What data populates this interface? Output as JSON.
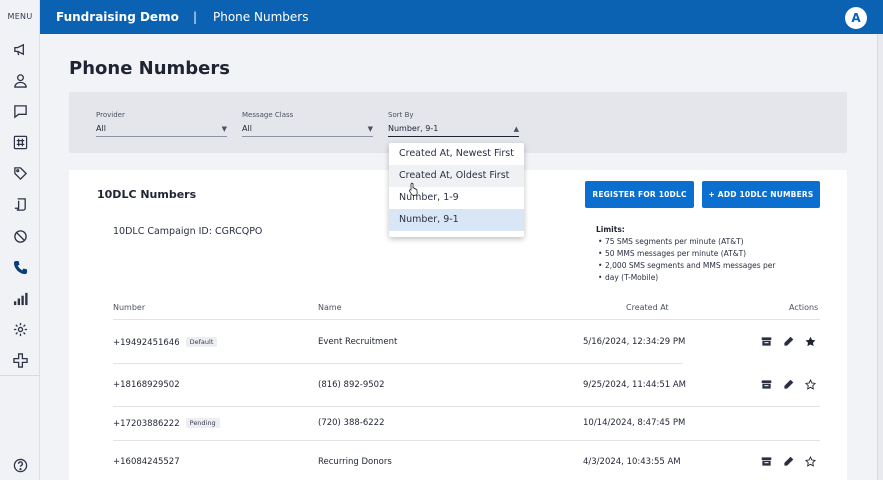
{
  "sidebar": {
    "menu_label": "MENU",
    "icons": [
      "megaphone-icon",
      "person-icon",
      "chat-bubble-icon",
      "hashtag-icon",
      "tag-icon",
      "script-icon",
      "block-icon",
      "phone-icon",
      "bar-chart-icon",
      "gear-icon",
      "puzzle-icon"
    ],
    "help_icon": "help-icon"
  },
  "topbar": {
    "app_title": "Fundraising Demo",
    "separator": "|",
    "breadcrumb": "Phone Numbers",
    "avatar_initial": "A"
  },
  "page": {
    "title": "Phone Numbers"
  },
  "filters": {
    "provider": {
      "label": "Provider",
      "value": "All"
    },
    "message_class": {
      "label": "Message Class",
      "value": "All"
    },
    "sort_by": {
      "label": "Sort By",
      "value": "Number, 9-1"
    }
  },
  "sort_dropdown": {
    "options": [
      "Created At, Newest First",
      "Created At, Oldest First",
      "Number, 1-9",
      "Number, 9-1"
    ],
    "hovered": "Created At, Oldest First",
    "selected": "Number, 9-1"
  },
  "card": {
    "title": "10DLC Numbers",
    "register_button": "REGISTER FOR 10DLC",
    "add_button": "+ ADD 10DLC NUMBERS",
    "campaign_id": "10DLC Campaign ID: CGRCQPO",
    "limits_title": "Limits:",
    "limits": [
      "75 SMS segments per minute (AT&T)",
      "50 MMS messages per minute (AT&T)",
      "2,000 SMS segments and MMS messages per",
      "day (T-Mobile)"
    ]
  },
  "table": {
    "headers": {
      "number": "Number",
      "name": "Name",
      "created_at": "Created At",
      "actions": "Actions"
    },
    "rows": [
      {
        "number": "+19492451646",
        "badge": "Default",
        "name": "Event Recruitment",
        "created_at": "5/16/2024, 12:34:29 PM",
        "star": "filled"
      },
      {
        "number": "+18168929502",
        "badge": "",
        "name": "(816) 892-9502",
        "created_at": "9/25/2024, 11:44:51 AM",
        "star": "outline"
      },
      {
        "number": "+17203886222",
        "badge": "Pending",
        "name": "(720) 388-6222",
        "created_at": "10/14/2024, 8:47:45 PM",
        "star": "none"
      },
      {
        "number": "+16084245527",
        "badge": "",
        "name": "Recurring Donors",
        "created_at": "4/3/2024, 10:43:55 AM",
        "star": "outline"
      }
    ]
  },
  "colors": {
    "brand_blue": "#0b62b3",
    "button_blue": "#0b6fd0",
    "selected_option": "#d9e6f5"
  }
}
